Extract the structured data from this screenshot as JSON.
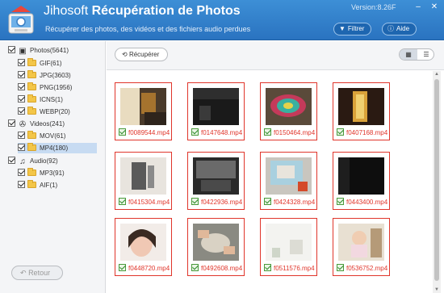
{
  "header": {
    "brand": "Jihosoft",
    "product": "Récupération de Photos",
    "subtitle": "Récupérer des photos, des vidéos et des fichiers audio perdues",
    "version": "Version:8.26F",
    "filter_label": "Filtrer",
    "help_label": "Aide",
    "minimize_glyph": "–",
    "close_glyph": "✕",
    "colors": {
      "bar_top": "#3d8fd6",
      "bar_bottom": "#2a73c0"
    }
  },
  "sidebar": {
    "categories": [
      {
        "label": "Photos(5641)",
        "icon": "image-icon",
        "checked": true,
        "folders": [
          {
            "label": "GIF(61)",
            "checked": true
          },
          {
            "label": "JPG(3603)",
            "checked": true
          },
          {
            "label": "PNG(1956)",
            "checked": true
          },
          {
            "label": "ICNS(1)",
            "checked": true
          },
          {
            "label": "WEBP(20)",
            "checked": true
          }
        ]
      },
      {
        "label": "Videos(241)",
        "icon": "film-reel-icon",
        "checked": true,
        "folders": [
          {
            "label": "MOV(61)",
            "checked": true
          },
          {
            "label": "MP4(180)",
            "checked": true,
            "selected": true
          }
        ]
      },
      {
        "label": "Audio(92)",
        "icon": "music-note-icon",
        "checked": true,
        "folders": [
          {
            "label": "MP3(91)",
            "checked": true
          },
          {
            "label": "AIF(1)",
            "checked": true
          }
        ]
      }
    ],
    "back_label": "Retour"
  },
  "toolbar": {
    "recover_label": "Récupérer",
    "view_grid": "grid-view-icon",
    "view_list": "list-view-icon",
    "active_view": "grid"
  },
  "files": [
    {
      "name": "f0089544.mp4",
      "checked": true
    },
    {
      "name": "f0147648.mp4",
      "checked": true
    },
    {
      "name": "f0150464.mp4",
      "checked": true
    },
    {
      "name": "f0407168.mp4",
      "checked": true
    },
    {
      "name": "f0415304.mp4",
      "checked": true
    },
    {
      "name": "f0422936.mp4",
      "checked": true
    },
    {
      "name": "f0424328.mp4",
      "checked": true
    },
    {
      "name": "f0443400.mp4",
      "checked": true
    },
    {
      "name": "f0448720.mp4",
      "checked": true
    },
    {
      "name": "f0492608.mp4",
      "checked": true
    },
    {
      "name": "f0511576.mp4",
      "checked": true
    },
    {
      "name": "f0536752.mp4",
      "checked": true
    }
  ],
  "accent_selected": "#e0352b"
}
